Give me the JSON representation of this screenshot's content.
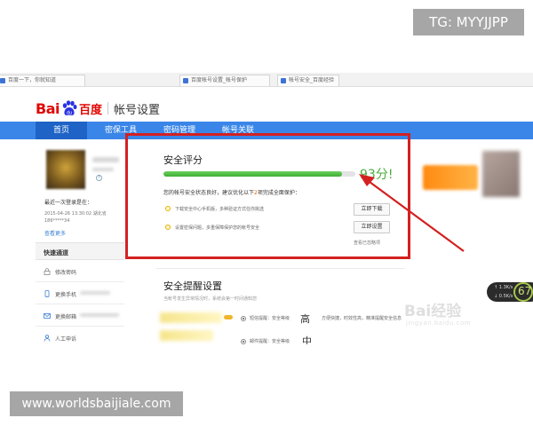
{
  "watermark_tag": "TG: MYYJJPP",
  "url_badge": "www.worldsbaijiale.com",
  "browser_tabs": [
    "百度一下，你就知道",
    "百度帐号设置_帐号保护",
    "帐号安全_百度经验"
  ],
  "logo": {
    "bai": "Bai",
    "du": "百度",
    "title": "帐号设置"
  },
  "nav": {
    "items": [
      "首页",
      "密保工具",
      "密码管理",
      "帐号关联"
    ],
    "active_index": 0
  },
  "sidebar": {
    "last_login_label": "最近一次登录是在：",
    "last_login_date": "2015-04-26 13:30:02",
    "last_login_place": "湖北省",
    "last_login_phone": "186*****34",
    "view_more": "查看更多",
    "quick_title": "快速通道",
    "quick_items": [
      "修改密码",
      "更换手机",
      "更换邮箱",
      "人工申诉"
    ]
  },
  "security": {
    "title": "安全评分",
    "score_value": 93,
    "score_text": "93分!",
    "status_prefix": "您的帐号安全状态良好，建议优化以下",
    "status_count": "2",
    "status_suffix": "项完成全面保护：",
    "tips": [
      "下载安全中心手机版，多种验证方式任你挑选",
      "设置密保问题，多重保障保护您的帐号安全"
    ],
    "action_buttons": [
      "立即下载",
      "立即设置"
    ],
    "view_ignored": "查看已忽略项"
  },
  "reminder": {
    "title": "安全提醒设置",
    "subtitle": "当帐号发生异常情况时，系统会第一时间通知您",
    "option_label": "短信提醒：安全等级",
    "level_high": "高",
    "level_mid": "中",
    "detail": "方便快捷，时效性高，精准提醒安全信息",
    "second_line": "邮件提醒：安全等级"
  },
  "float_widget": {
    "value": "67",
    "rows": [
      "1.3K/s",
      "0.5K/s"
    ]
  },
  "baidu_jingyan": {
    "text": "Bai经验",
    "url": "jingyan.baidu.com"
  },
  "colors": {
    "brand_red": "#e10602",
    "nav_blue": "#3a86e8",
    "nav_active": "#1f63c6",
    "score_green": "#48ad3c",
    "highlight_frame": "#d42020"
  }
}
